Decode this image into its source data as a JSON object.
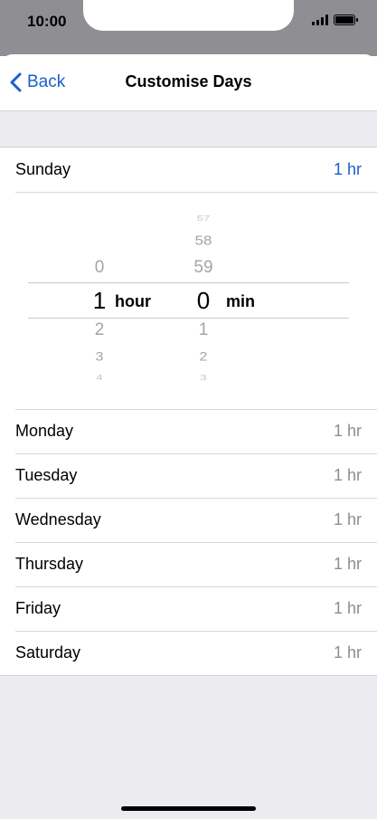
{
  "status_bar": {
    "time": "10:00",
    "signal_icon": "cellular-signal-icon",
    "battery_icon": "battery-icon"
  },
  "nav": {
    "back_label": "Back",
    "title": "Customise Days",
    "back_icon": "chevron-left-icon"
  },
  "days": {
    "sunday": {
      "label": "Sunday",
      "value": "1 hr"
    },
    "monday": {
      "label": "Monday",
      "value": "1 hr"
    },
    "tuesday": {
      "label": "Tuesday",
      "value": "1 hr"
    },
    "wednesday": {
      "label": "Wednesday",
      "value": "1 hr"
    },
    "thursday": {
      "label": "Thursday",
      "value": "1 hr"
    },
    "friday": {
      "label": "Friday",
      "value": "1 hr"
    },
    "saturday": {
      "label": "Saturday",
      "value": "1 hr"
    }
  },
  "picker": {
    "hours": {
      "above": [
        "0"
      ],
      "selected": "1",
      "below": [
        "2",
        "3",
        "4"
      ],
      "unit": "hour"
    },
    "minutes": {
      "above": [
        "57",
        "58",
        "59"
      ],
      "selected": "0",
      "below": [
        "1",
        "2",
        "3"
      ],
      "unit": "min"
    }
  },
  "colors": {
    "accent": "#1a5fcc",
    "secondary_text": "#8e8e93",
    "grouped_background": "#ebebf0",
    "bezel": "#8e8e93"
  }
}
